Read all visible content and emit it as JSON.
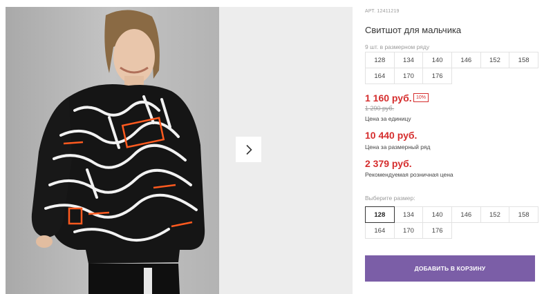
{
  "product": {
    "article": "АРТ. 12411219",
    "title": "Свитшот для мальчика",
    "row_count": "9 шт. в размерном ряду",
    "row_sizes": [
      "128",
      "134",
      "140",
      "146",
      "152",
      "158",
      "164",
      "170",
      "176"
    ],
    "price_unit": "1 160 руб.",
    "discount": "10%",
    "price_old": "1 290 руб.",
    "price_unit_label": "Цена за единицу",
    "price_set": "10 440 руб.",
    "price_set_label": "Цена за размерный ряд",
    "price_rrp": "2 379 руб.",
    "price_rrp_label": "Рекомендуемая розничная цена",
    "choose_label": "Выберите размер:",
    "sizes": [
      "128",
      "134",
      "140",
      "146",
      "152",
      "158",
      "164",
      "170",
      "176"
    ],
    "selected_size": "128",
    "add_to_cart": "ДОБАВИТЬ В КОРЗИНУ"
  },
  "colors": {
    "price": "#d52d2d",
    "accent": "#7b5ea7"
  },
  "icons": {
    "next": "chevron-right-icon"
  }
}
